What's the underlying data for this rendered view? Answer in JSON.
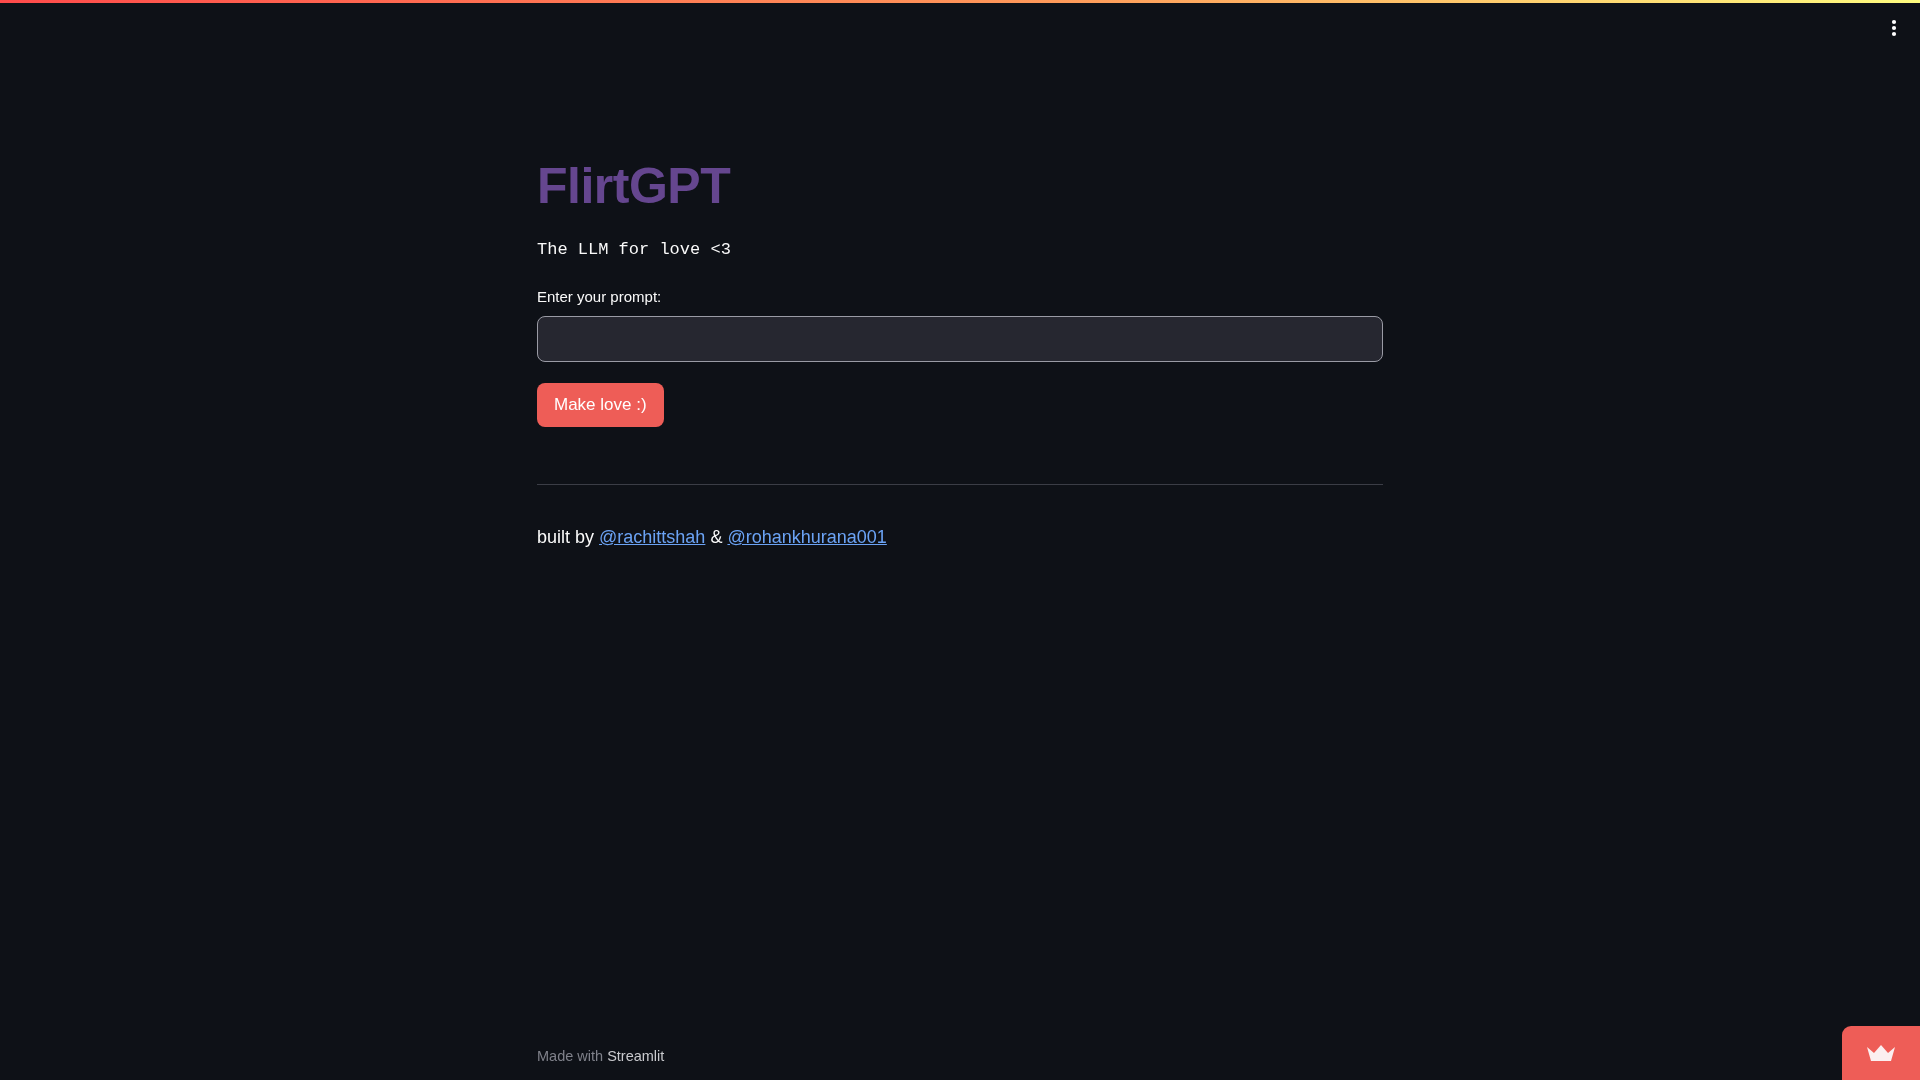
{
  "title": "FlirtGPT",
  "subtitle": "The LLM for love <3",
  "prompt_field": {
    "label": "Enter your prompt:"
  },
  "submit_button": {
    "label": "Make love :)"
  },
  "credits": {
    "lead": "built by",
    "links": [
      "@rachittshah",
      "@rohankhurana001"
    ],
    "joiner": "&"
  },
  "footer": {
    "text": "Made with **Streamlit**"
  }
}
